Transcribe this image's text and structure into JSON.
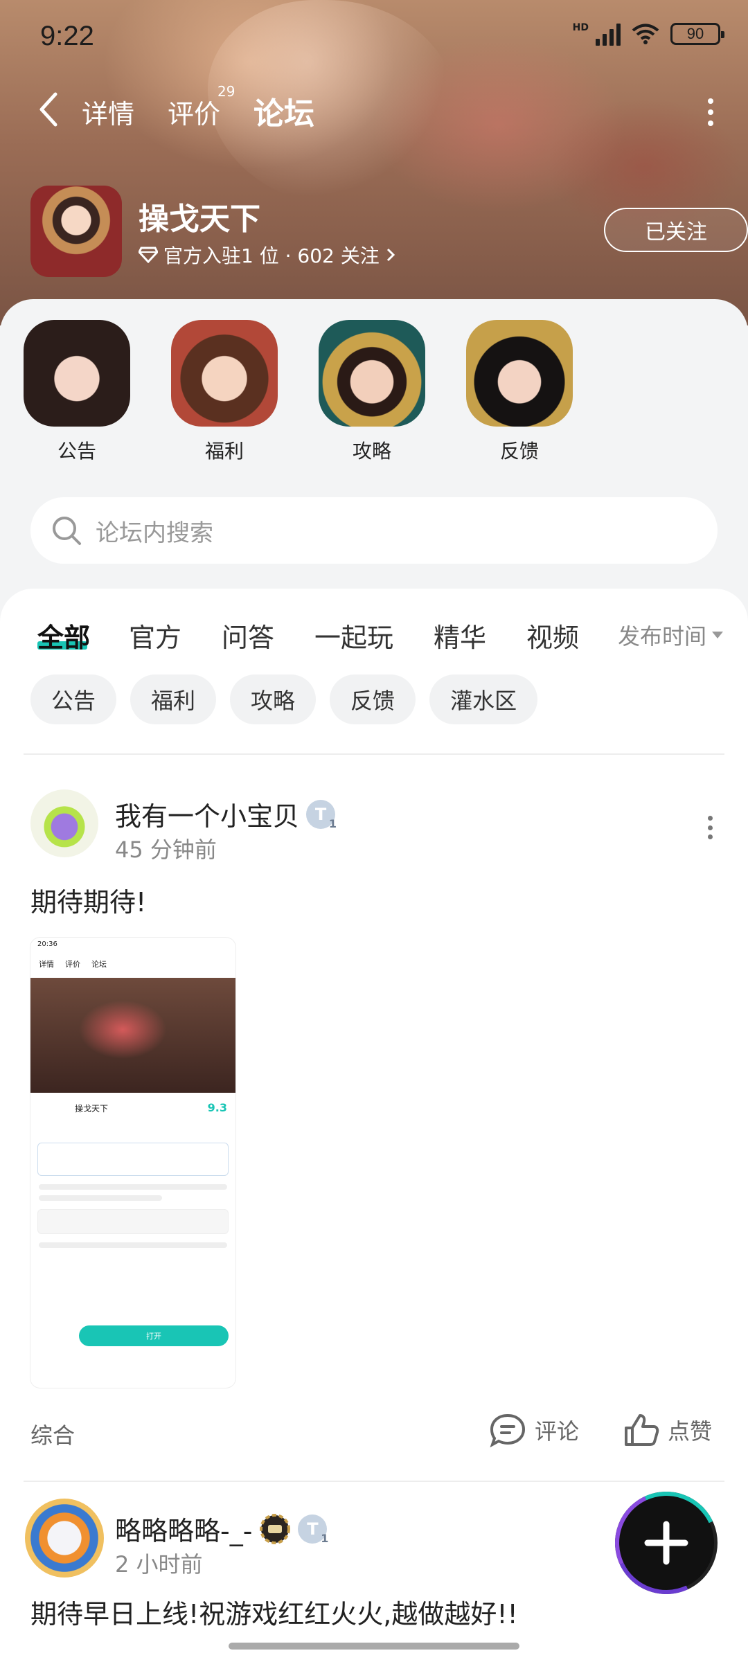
{
  "status_bar": {
    "time": "9:22",
    "network": "HD",
    "battery": "90"
  },
  "nav": {
    "tabs": [
      "详情",
      "评价",
      "论坛"
    ],
    "active_tab": "论坛",
    "review_count": "29"
  },
  "game": {
    "name": "操戈天下",
    "subtitle": "官方入驻1 位 · 602 关注",
    "follow_label": "已关注"
  },
  "categories": [
    "公告",
    "福利",
    "攻略",
    "反馈"
  ],
  "search": {
    "placeholder": "论坛内搜索"
  },
  "feed_tabs": [
    "全部",
    "官方",
    "问答",
    "一起玩",
    "精华",
    "视频"
  ],
  "sort_label": "发布时间",
  "chips": [
    "公告",
    "福利",
    "攻略",
    "反馈",
    "灌水区"
  ],
  "posts": [
    {
      "user": "我有一个小宝贝",
      "time": "45 分钟前",
      "text": "期待期待!",
      "category": "综合",
      "comment_label": "评论",
      "like_label": "点赞",
      "screenshot": {
        "time": "20:36",
        "tabs": [
          "详情",
          "评价",
          "论坛"
        ],
        "game_name": "操戈天下",
        "score": "9.3",
        "button": "打开"
      }
    },
    {
      "user": "略略略略-_-",
      "time": "2 小时前",
      "text": "期待早日上线!祝游戏红红火火,越做越好!!"
    }
  ],
  "colors": {
    "accent": "#19c5b5",
    "hero_bg": "#9a6c55"
  }
}
